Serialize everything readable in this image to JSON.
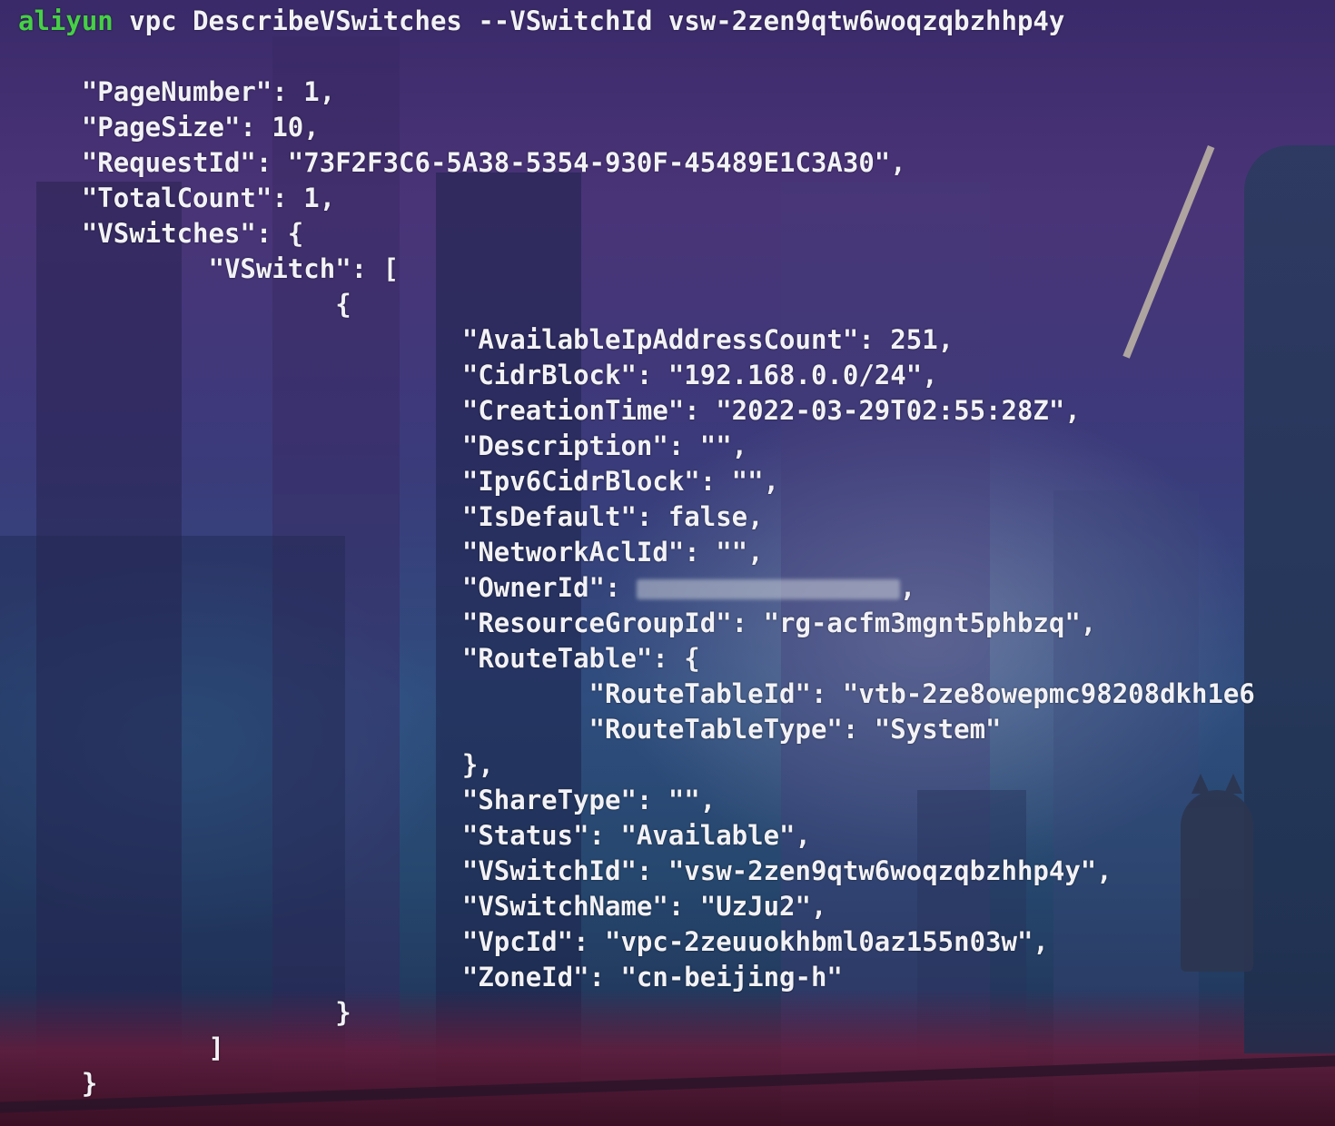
{
  "command": {
    "program": "aliyun",
    "args": "vpc DescribeVSwitches --VSwitchId vsw-2zen9qtw6woqzqbzhhp4y"
  },
  "output_lines": [
    "    \"PageNumber\": 1,",
    "    \"PageSize\": 10,",
    "    \"RequestId\": \"73F2F3C6-5A38-5354-930F-45489E1C3A30\",",
    "    \"TotalCount\": 1,",
    "    \"VSwitches\": {",
    "            \"VSwitch\": [",
    "                    {",
    "                            \"AvailableIpAddressCount\": 251,",
    "                            \"CidrBlock\": \"192.168.0.0/24\",",
    "                            \"CreationTime\": \"2022-03-29T02:55:28Z\",",
    "                            \"Description\": \"\",",
    "                            \"Ipv6CidrBlock\": \"\",",
    "                            \"IsDefault\": false,",
    "                            \"NetworkAclId\": \"\",",
    "                            \"OwnerId\": ",
    "                            \"ResourceGroupId\": \"rg-acfm3mgnt5phbzq\",",
    "                            \"RouteTable\": {",
    "                                    \"RouteTableId\": \"vtb-2ze8owepmc98208dkh1e6",
    "                                    \"RouteTableType\": \"System\"",
    "                            },",
    "                            \"ShareType\": \"\",",
    "                            \"Status\": \"Available\",",
    "                            \"VSwitchId\": \"vsw-2zen9qtw6woqzqbzhhp4y\",",
    "                            \"VSwitchName\": \"UzJu2\",",
    "                            \"VpcId\": \"vpc-2zeuuokhbml0az155n03w\",",
    "                            \"ZoneId\": \"cn-beijing-h\"",
    "                    }",
    "            ]",
    "    }"
  ],
  "owner_id_suffix": ",",
  "colors": {
    "prompt": "#46d046",
    "text": "#f2f2f6"
  }
}
